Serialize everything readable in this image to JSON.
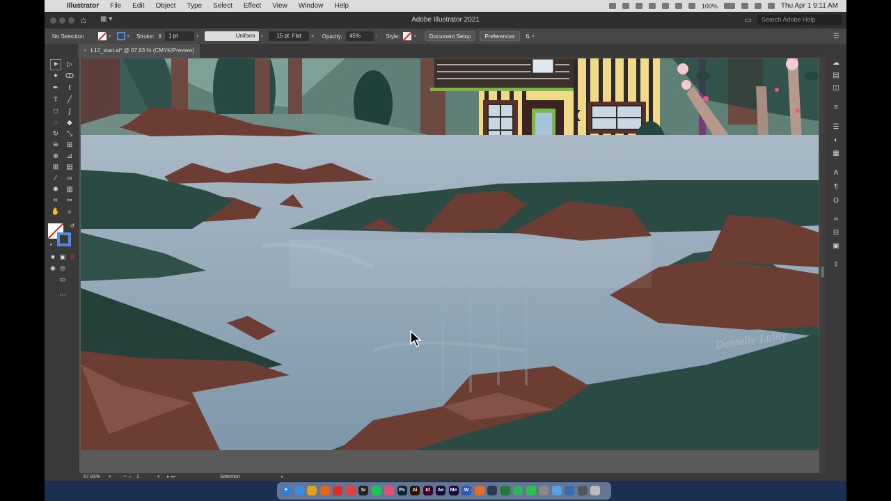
{
  "menubar": {
    "app_name": "Illustrator",
    "items": [
      "File",
      "Edit",
      "Object",
      "Type",
      "Select",
      "Effect",
      "View",
      "Window",
      "Help"
    ],
    "battery": "100%",
    "datetime": "Thu Apr 1  9:11 AM"
  },
  "titlebar": {
    "title": "Adobe Illustrator 2021",
    "search_placeholder": "Search Adobe Help"
  },
  "controlbar": {
    "selection": "No Selection",
    "stroke_label": "Stroke:",
    "stroke_weight": "1 pt",
    "stroke_profile": "Uniform",
    "brush": "15 pt. Flat",
    "opacity_label": "Opacity:",
    "opacity_value": "45%",
    "style_label": "Style:",
    "document_setup": "Document Setup",
    "preferences": "Preferences"
  },
  "document": {
    "tab_title": "L12_start.ai* @ 67.83 % (CMYK/Preview)",
    "close": "×"
  },
  "artwork": {
    "signature": "Danielle Lulay"
  },
  "statusbar": {
    "zoom": "67.83%",
    "artboard": "1",
    "tool": "Selection"
  },
  "colors": {
    "fill": "#ffffff",
    "stroke": "#4e8bdc",
    "water": "#8fa6b6",
    "rocks": "#6a3e34",
    "grass": "#2b4a44"
  },
  "dock": {
    "apps": [
      {
        "label": "F",
        "color": "#2f7fd8"
      },
      {
        "label": "",
        "color": "#3c8ce0"
      },
      {
        "label": "",
        "color": "#e0a020"
      },
      {
        "label": "",
        "color": "#e66420"
      },
      {
        "label": "",
        "color": "#d43030"
      },
      {
        "label": "",
        "color": "#e04040"
      },
      {
        "label": "tv",
        "color": "#222222"
      },
      {
        "label": "",
        "color": "#1ec45a"
      },
      {
        "label": "",
        "color": "#e05070"
      },
      {
        "label": "Ps",
        "color": "#0e2436"
      },
      {
        "label": "Ai",
        "color": "#2e1400"
      },
      {
        "label": "Id",
        "color": "#3d0024"
      },
      {
        "label": "Ae",
        "color": "#1a0a3a"
      },
      {
        "label": "Me",
        "color": "#160b40"
      },
      {
        "label": "W",
        "color": "#2b5bb8"
      },
      {
        "label": "",
        "color": "#e07030"
      },
      {
        "label": "",
        "color": "#2a3a50"
      },
      {
        "label": "",
        "color": "#1e7a3a"
      },
      {
        "label": "",
        "color": "#30b060"
      },
      {
        "label": "",
        "color": "#30c050"
      },
      {
        "label": "",
        "color": "#8a8a8a"
      },
      {
        "label": "",
        "color": "#5aa0e8"
      },
      {
        "label": "",
        "color": "#3a6ab0"
      },
      {
        "label": "",
        "color": "#555555"
      },
      {
        "label": "",
        "color": "#bbbbbb"
      }
    ]
  }
}
